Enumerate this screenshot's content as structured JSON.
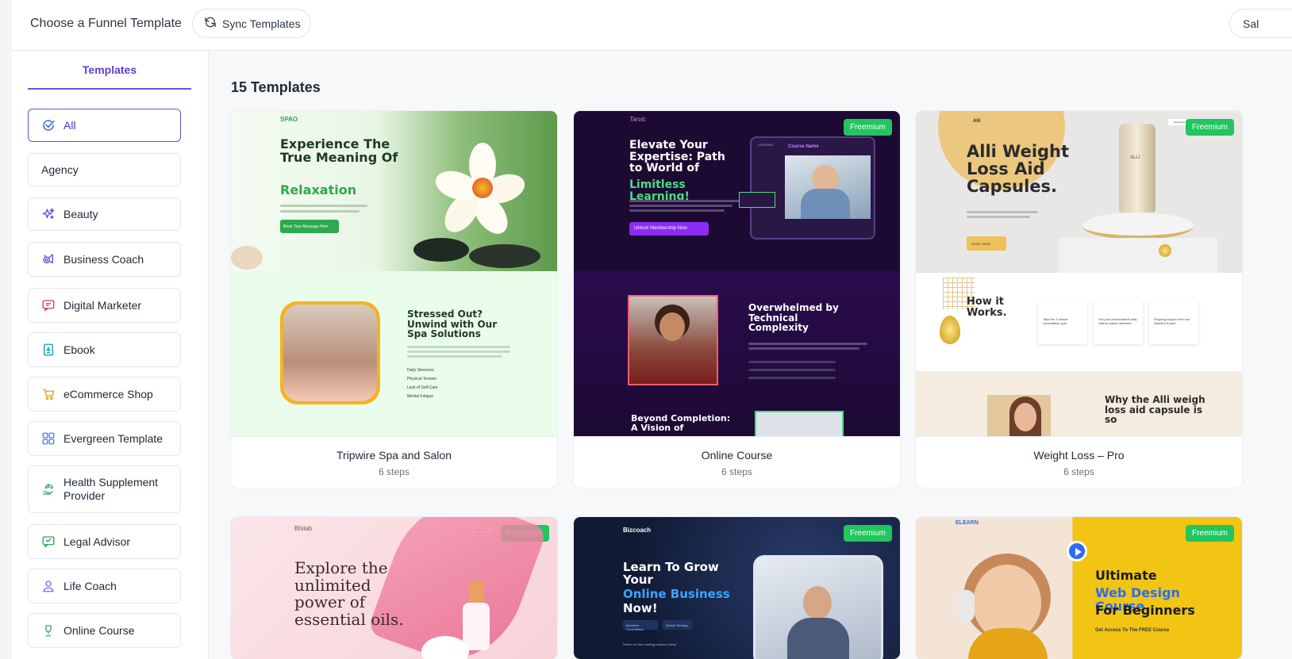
{
  "header": {
    "title": "Choose a Funnel Template",
    "sync_label": "Sync Templates",
    "right_label": "Sal"
  },
  "sidebar": {
    "tab": "Templates",
    "categories": [
      {
        "label": "All",
        "icon": "check-circle-icon",
        "active": true
      },
      {
        "label": "Agency",
        "icon": ""
      },
      {
        "label": "Beauty",
        "icon": "sparkles-icon"
      },
      {
        "label": "Business Coach",
        "icon": "megaphone-icon"
      },
      {
        "label": "Digital Marketer",
        "icon": "chat-icon"
      },
      {
        "label": "Ebook",
        "icon": "book-download-icon"
      },
      {
        "label": "eCommerce Shop",
        "icon": "cart-icon"
      },
      {
        "label": "Evergreen Template",
        "icon": "grid-icon"
      },
      {
        "label": "Health Supplement Provider",
        "icon": "leaf-hand-icon"
      },
      {
        "label": "Legal Advisor",
        "icon": "legal-chat-icon"
      },
      {
        "label": "Life Coach",
        "icon": "person-icon"
      },
      {
        "label": "Online Course",
        "icon": "trophy-icon"
      }
    ]
  },
  "main": {
    "count_label": "15 Templates",
    "badge_label": "Freemium",
    "cards": [
      {
        "name": "Tripwire Spa and Salon",
        "steps": "6 steps",
        "brand": "SPAO",
        "headline": "Experience The True Meaning Of",
        "headline_accent": "Relaxation",
        "cta": "Book Your Massage Here",
        "sub_headline": "Stressed Out? Unwind with Our Spa Solutions",
        "list": [
          "Daily Stressors",
          "Physical Tension",
          "Lack of Self-Care",
          "Mental Fatigue"
        ]
      },
      {
        "name": "Online Course",
        "steps": "6 steps",
        "badge": true,
        "brand": "Tarvic",
        "headline": "Elevate Your Expertise: Path to World of",
        "headline_accent": "Limitless Learning!",
        "cta": "Unlock Membership Now",
        "sub_headline": "Overwhelmed by Technical Complexity",
        "footer_headline": "Beyond Completion: A Vision of",
        "screen_title": "Course Name",
        "screen_label": "LESSONS"
      },
      {
        "name": "Weight Loss – Pro",
        "steps": "6 steps",
        "badge": true,
        "brand": "Alli",
        "headline": "Alli Weight Loss Aid Capsules.",
        "cta": "START NOW",
        "sub_headline": "How it Works.",
        "footer_headline": "Why the Alli weigh loss aid capsule is so",
        "bottle_label": "ALLI",
        "shop_label": "Shop Now",
        "steps_list": [
          "Take the 3 minute consultation quiz",
          "Get your personalized daily vitamin packs delivered",
          "Ongoing support from our Nutrition Expert"
        ]
      },
      {
        "name": "",
        "steps": "",
        "badge": true,
        "brand": "Bhilab",
        "headline": "Explore the unlimited power of essential oils.",
        "shop_label": "Shop Now"
      },
      {
        "name": "",
        "steps": "",
        "badge": true,
        "brand": "Bizcoach",
        "headline": "Learn To Grow Your",
        "headline_accent": "Online Business",
        "headline_end": "Now!",
        "sub": "Watch my free strategy session today!",
        "chips": [
          "Business Consultation",
          "Market Strategy"
        ]
      },
      {
        "name": "",
        "steps": "",
        "badge": true,
        "brand": "ELEARN",
        "headline": "Ultimate",
        "headline_accent": "Web Design Course",
        "headline_end": "For Beginners",
        "sub": "Get Access To The FREE Course"
      }
    ]
  },
  "colors": {
    "accent": "#6c4ed9",
    "freemium": "#22c55e",
    "spa_green": "#2fa84f",
    "course_purple": "#1d0a33",
    "course_accent": "#8b2cf5",
    "learn_yellow": "#f2c414"
  }
}
